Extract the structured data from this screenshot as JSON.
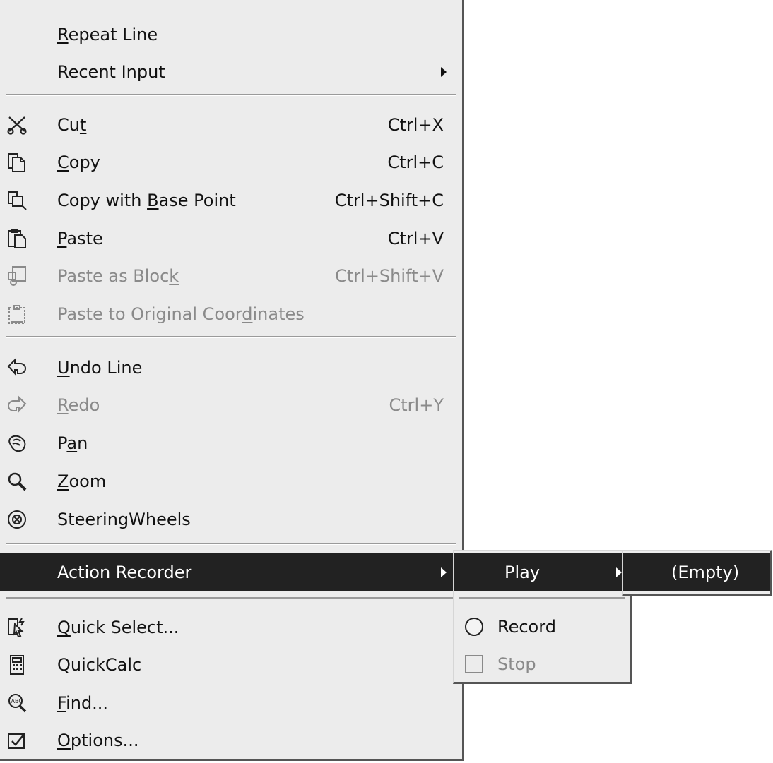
{
  "main_menu": {
    "items": [
      {
        "key": "repeat_line",
        "pre": "",
        "u": "R",
        "post": "epeat Line",
        "shortcut": "",
        "icon": "none"
      },
      {
        "key": "recent_input",
        "pre": "Recent Input",
        "u": "",
        "post": "",
        "shortcut": "",
        "icon": "none",
        "submenu": true
      },
      {
        "key": "cut",
        "pre": "Cu",
        "u": "t",
        "post": "",
        "shortcut": "Ctrl+X",
        "icon": "scissors-icon"
      },
      {
        "key": "copy",
        "pre": "",
        "u": "C",
        "post": "opy",
        "shortcut": "Ctrl+C",
        "icon": "copy-icon"
      },
      {
        "key": "copy_base",
        "pre": "Copy with ",
        "u": "B",
        "post": "ase Point",
        "shortcut": "Ctrl+Shift+C",
        "icon": "copy-base-point-icon"
      },
      {
        "key": "paste",
        "pre": "",
        "u": "P",
        "post": "aste",
        "shortcut": "Ctrl+V",
        "icon": "paste-icon"
      },
      {
        "key": "paste_block",
        "pre": "Paste as Bloc",
        "u": "k",
        "post": "",
        "shortcut": "Ctrl+Shift+V",
        "icon": "paste-block-icon",
        "disabled": true
      },
      {
        "key": "paste_orig",
        "pre": "Paste to Original Coor",
        "u": "d",
        "post": "inates",
        "shortcut": "",
        "icon": "paste-coordinates-icon",
        "disabled": true
      },
      {
        "key": "undo",
        "pre": "",
        "u": "U",
        "post": "ndo Line",
        "shortcut": "",
        "icon": "undo-icon"
      },
      {
        "key": "redo",
        "pre": "",
        "u": "R",
        "post": "edo",
        "shortcut": "Ctrl+Y",
        "icon": "redo-icon",
        "disabled": true
      },
      {
        "key": "pan",
        "pre": "P",
        "u": "a",
        "post": "n",
        "shortcut": "",
        "icon": "pan-hand-icon"
      },
      {
        "key": "zoom",
        "pre": "",
        "u": "Z",
        "post": "oom",
        "shortcut": "",
        "icon": "magnifier-icon"
      },
      {
        "key": "steering",
        "pre": "SteeringWheels",
        "u": "",
        "post": "",
        "shortcut": "",
        "icon": "steering-wheel-icon"
      },
      {
        "key": "action_recorder",
        "pre": "Action Recorder",
        "u": "",
        "post": "",
        "shortcut": "",
        "icon": "none",
        "submenu": true,
        "highlight": true
      },
      {
        "key": "quick_select",
        "pre": "",
        "u": "Q",
        "post": "uick Select...",
        "shortcut": "",
        "icon": "quick-select-icon"
      },
      {
        "key": "quickcalc",
        "pre": "QuickCalc",
        "u": "",
        "post": "",
        "shortcut": "",
        "icon": "calculator-icon"
      },
      {
        "key": "find",
        "pre": "",
        "u": "F",
        "post": "ind...",
        "shortcut": "",
        "icon": "find-abc-icon"
      },
      {
        "key": "options",
        "pre": "",
        "u": "O",
        "post": "ptions...",
        "shortcut": "",
        "icon": "options-checkbox-icon"
      }
    ]
  },
  "action_recorder_menu": {
    "play": "Play",
    "record": "Record",
    "stop": "Stop"
  },
  "play_menu": {
    "empty": "(Empty)"
  },
  "colors": {
    "menu_bg": "#ececec",
    "highlight_bg": "#222222",
    "disabled_text": "#8a8a8a"
  }
}
